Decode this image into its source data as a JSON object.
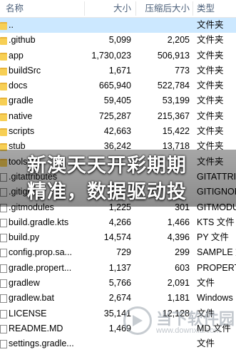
{
  "header": {
    "name": "名称",
    "size": "大小",
    "compressed_size": "压缩后大小",
    "type": "类型"
  },
  "rows": [
    {
      "icon": "folder-up-icon",
      "name": "..",
      "size": "",
      "compressed": "",
      "type": "文件夹",
      "selected": true
    },
    {
      "icon": "folder-icon",
      "name": ".github",
      "size": "5,099",
      "compressed": "2,205",
      "type": "文件夹"
    },
    {
      "icon": "folder-icon",
      "name": "app",
      "size": "1,730,023",
      "compressed": "506,913",
      "type": "文件夹"
    },
    {
      "icon": "folder-icon",
      "name": "buildSrc",
      "size": "1,671",
      "compressed": "773",
      "type": "文件夹"
    },
    {
      "icon": "folder-icon",
      "name": "docs",
      "size": "665,940",
      "compressed": "522,784",
      "type": "文件夹"
    },
    {
      "icon": "folder-icon",
      "name": "gradle",
      "size": "59,405",
      "compressed": "53,199",
      "type": "文件夹"
    },
    {
      "icon": "folder-icon",
      "name": "native",
      "size": "725,287",
      "compressed": "215,367",
      "type": "文件夹"
    },
    {
      "icon": "folder-icon",
      "name": "scripts",
      "size": "42,663",
      "compressed": "15,422",
      "type": "文件夹"
    },
    {
      "icon": "folder-icon",
      "name": "stub",
      "size": "36,242",
      "compressed": "13,718",
      "type": "文件夹"
    },
    {
      "icon": "folder-icon",
      "name": "tools",
      "size": "",
      "compressed": "",
      "type": "文件夹"
    },
    {
      "icon": "file-icon",
      "name": ".gitattributes",
      "size": "",
      "compressed": "",
      "type": "GITATTRI"
    },
    {
      "icon": "file-icon",
      "name": ".gitignore",
      "size": "",
      "compressed": "",
      "type": "GITIGNOR"
    },
    {
      "icon": "file-icon",
      "name": ".gitmodules",
      "size": "1,225",
      "compressed": "301",
      "type": "GITMODUL"
    },
    {
      "icon": "file-icon",
      "name": "build.gradle.kts",
      "size": "4,266",
      "compressed": "1,466",
      "type": "KTS 文件"
    },
    {
      "icon": "file-icon",
      "name": "build.py",
      "size": "14,574",
      "compressed": "4,396",
      "type": "PY 文件"
    },
    {
      "icon": "file-icon",
      "name": "config.prop.sa...",
      "size": "729",
      "compressed": "299",
      "type": "SAMPLE 文"
    },
    {
      "icon": "file-icon",
      "name": "gradle.propert...",
      "size": "1,137",
      "compressed": "603",
      "type": "PROPERT"
    },
    {
      "icon": "file-icon",
      "name": "gradlew",
      "size": "5,766",
      "compressed": "2,091",
      "type": "文件"
    },
    {
      "icon": "file-icon",
      "name": "gradlew.bat",
      "size": "2,674",
      "compressed": "1,181",
      "type": "Windows"
    },
    {
      "icon": "file-icon",
      "name": "LICENSE",
      "size": "35,141",
      "compressed": "12,128",
      "type": "文件"
    },
    {
      "icon": "file-icon",
      "name": "README.MD",
      "size": "1,469",
      "compressed": "",
      "type": "MD 文件"
    },
    {
      "icon": "file-icon",
      "name": "settings.gradle...",
      "size": "",
      "compressed": "",
      "type": "文件"
    }
  ],
  "overlay": {
    "line1": "新澳天天开彩期期",
    "line2": "精准，数据驱动投"
  },
  "watermark": {
    "title": "当下软件园",
    "url": "www.downxia.com"
  },
  "colors": {
    "selected_row": "#cce8ff",
    "header_text": "#4c607a",
    "folder": "#f7cf55"
  }
}
